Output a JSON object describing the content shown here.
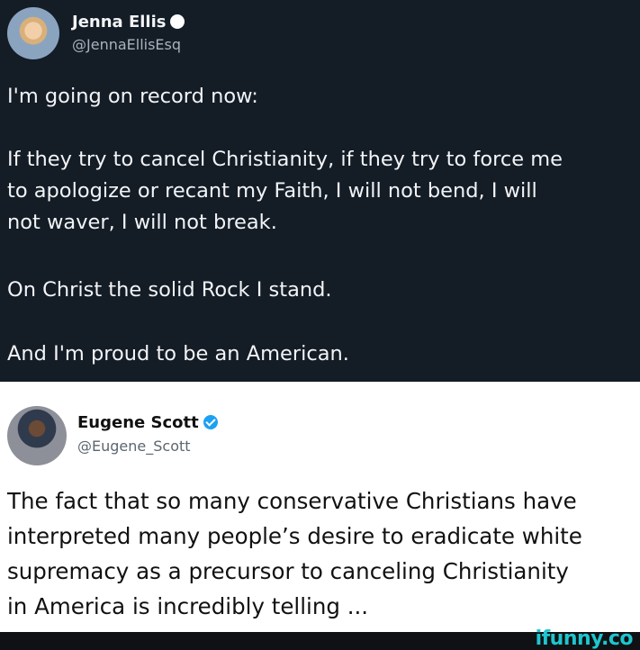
{
  "tweet1": {
    "name": "Jenna Ellis",
    "handle": "@JennaEllisEsq",
    "verified_color": "#ffffff",
    "lines": [
      "I'm going on record now:",
      "If they try to cancel Christianity, if they try to force me",
      "to apologize or recant my Faith, I will not bend, I will",
      "not waver, I will not break.",
      "On Christ the solid Rock I stand.",
      "And I'm proud to be an American."
    ]
  },
  "tweet2": {
    "name": "Eugene Scott",
    "handle": "@Eugene_Scott",
    "verified_color": "#1da1f2",
    "lines": [
      "The fact that so many conservative Christians have",
      "interpreted many people’s desire to eradicate white",
      "supremacy as a precursor to canceling Christianity",
      "in America is incredibly telling ..."
    ]
  },
  "watermark": "ifunny.co",
  "colors": {
    "dark_bg": "#141c26",
    "light_bg": "#ffffff",
    "accent": "#1ec6cf"
  }
}
